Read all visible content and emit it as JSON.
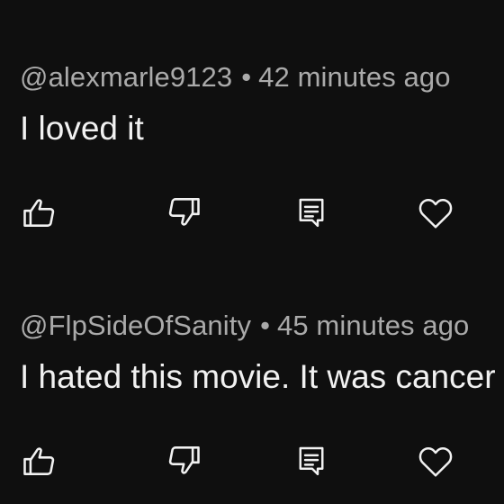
{
  "comments": [
    {
      "author": "@alexmarle9123",
      "separator": "•",
      "time": "42 minutes ago",
      "text": "I loved it"
    },
    {
      "author": "@FlpSideOfSanity",
      "separator": "•",
      "time": "45 minutes ago",
      "text": "I hated this movie. It was cancer"
    }
  ],
  "icons": {
    "like": "thumbs-up-icon",
    "dislike": "thumbs-down-icon",
    "reply": "comment-reply-icon",
    "heart": "heart-icon"
  },
  "colors": {
    "background": "#0f0f0f",
    "primary_text": "#f1f1f1",
    "secondary_text": "#aaaaaa"
  }
}
